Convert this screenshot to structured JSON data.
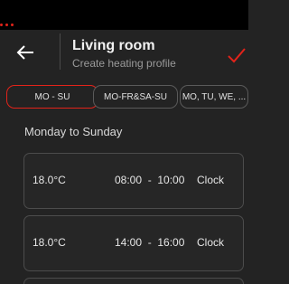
{
  "header": {
    "title": "Living room",
    "subtitle": "Create heating profile",
    "back_icon": "arrow-left-icon",
    "confirm_icon": "checkmark-icon"
  },
  "colors": {
    "accent": "#e2231a",
    "background": "#232323"
  },
  "tabs": [
    {
      "label": "MO - SU",
      "active": true
    },
    {
      "label": "MO-FR&SA-SU",
      "active": false
    },
    {
      "label": "MO, TU, WE, ...",
      "active": false
    }
  ],
  "section_label": "Monday to Sunday",
  "slots": [
    {
      "temperature": "18.0°C",
      "start": "08:00",
      "separator": "-",
      "end": "10:00",
      "mode": "Clock"
    },
    {
      "temperature": "18.0°C",
      "start": "14:00",
      "separator": "-",
      "end": "16:00",
      "mode": "Clock"
    }
  ]
}
